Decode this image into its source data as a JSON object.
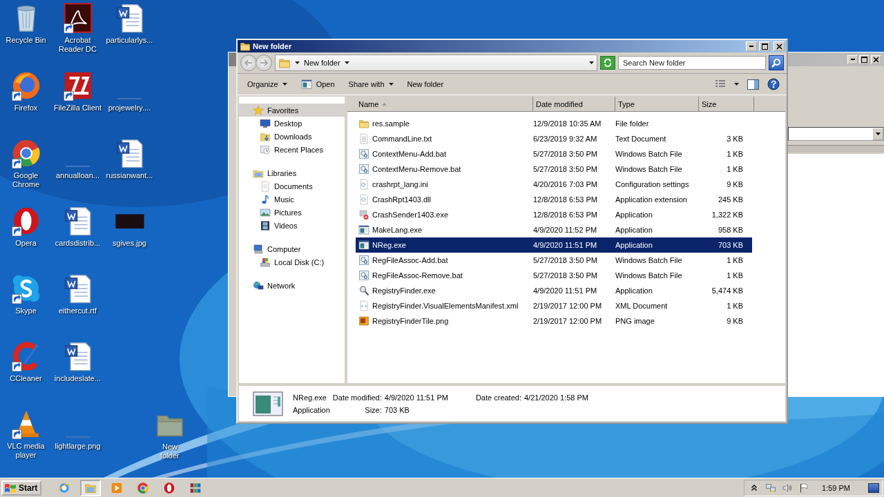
{
  "desktop": {
    "icons": [
      {
        "label": "Recycle Bin",
        "kind": "recycle",
        "shortcut": false
      },
      {
        "label": "Firefox",
        "kind": "firefox",
        "shortcut": true
      },
      {
        "label": "Google Chrome",
        "kind": "chrome",
        "shortcut": true
      },
      {
        "label": "Opera",
        "kind": "opera",
        "shortcut": true
      },
      {
        "label": "Skype",
        "kind": "skype",
        "shortcut": true
      },
      {
        "label": "CCleaner",
        "kind": "ccleaner",
        "shortcut": true
      },
      {
        "label": "VLC media player",
        "kind": "vlc",
        "shortcut": true
      },
      {
        "label": "Acrobat Reader DC",
        "kind": "pdf",
        "shortcut": true
      },
      {
        "label": "FileZilla Client",
        "kind": "filezilla",
        "shortcut": true
      },
      {
        "label": "annualloan...",
        "kind": "blank",
        "shortcut": false
      },
      {
        "label": "cardsdistrib...",
        "kind": "word",
        "shortcut": false
      },
      {
        "label": "eithercut.rtf",
        "kind": "word",
        "shortcut": false
      },
      {
        "label": "includeslate...",
        "kind": "word",
        "shortcut": false
      },
      {
        "label": "lightlarge.png",
        "kind": "blank",
        "shortcut": false
      },
      {
        "label": "particularlys...",
        "kind": "word",
        "shortcut": false
      },
      {
        "label": "projewelry....",
        "kind": "blank",
        "shortcut": false
      },
      {
        "label": "russianwant...",
        "kind": "word",
        "shortcut": false
      },
      {
        "label": "sgives.jpg",
        "kind": "darkimage",
        "shortcut": false
      }
    ],
    "dragged_icon": {
      "label": "New folder",
      "kind": "folder"
    }
  },
  "explorer": {
    "title": "New folder",
    "address": {
      "crumb": "New folder"
    },
    "search": {
      "placeholder": "Search New folder"
    },
    "toolbar": [
      {
        "label": "Organize",
        "kind": "menu"
      },
      {
        "label": "Open",
        "kind": "open"
      },
      {
        "label": "Share with",
        "kind": "menu"
      },
      {
        "label": "New folder",
        "kind": "plain"
      }
    ],
    "navigation": [
      {
        "label": "Favorites",
        "kind": "star",
        "selected": true,
        "children": [
          {
            "label": "Desktop",
            "kind": "desktop",
            "selected": false
          },
          {
            "label": "Downloads",
            "kind": "downloads",
            "selected": false
          },
          {
            "label": "Recent Places",
            "kind": "recent",
            "selected": false
          }
        ]
      },
      {
        "label": "Libraries",
        "kind": "libraries",
        "selected": false,
        "children": [
          {
            "label": "Documents",
            "kind": "documents",
            "selected": false
          },
          {
            "label": "Music",
            "kind": "music",
            "selected": false
          },
          {
            "label": "Pictures",
            "kind": "pictures",
            "selected": false
          },
          {
            "label": "Videos",
            "kind": "videos",
            "selected": false
          }
        ]
      },
      {
        "label": "Computer",
        "kind": "computer",
        "selected": false,
        "children": [
          {
            "label": "Local Disk (C:)",
            "kind": "disk",
            "selected": false
          }
        ]
      },
      {
        "label": "Network",
        "kind": "network",
        "selected": false
      }
    ],
    "columns": [
      {
        "label": "Name",
        "sorted": true
      },
      {
        "label": "Date modified",
        "sorted": false
      },
      {
        "label": "Type",
        "sorted": false
      },
      {
        "label": "Size",
        "sorted": false
      }
    ],
    "rows": [
      {
        "name": "res.sample",
        "date": "12/9/2018 10:35 AM",
        "type": "File folder",
        "kind": "folder",
        "selected": false
      },
      {
        "name": "CommandLine.txt",
        "date": "6/23/2019 9:32 AM",
        "type": "Text Document",
        "size": "3 KB",
        "kind": "text",
        "selected": false
      },
      {
        "name": "ContextMenu-Add.bat",
        "date": "5/27/2018 3:50 PM",
        "type": "Windows Batch File",
        "size": "1 KB",
        "kind": "batch",
        "selected": false
      },
      {
        "name": "ContextMenu-Remove.bat",
        "date": "5/27/2018 3:50 PM",
        "type": "Windows Batch File",
        "size": "1 KB",
        "kind": "batch",
        "selected": false
      },
      {
        "name": "crashrpt_lang.ini",
        "date": "4/20/2016 7:03 PM",
        "type": "Configuration settings",
        "size": "9 KB",
        "kind": "ini",
        "selected": false
      },
      {
        "name": "CrashRpt1403.dll",
        "date": "12/8/2018 6:53 PM",
        "type": "Application extension",
        "size": "245 KB",
        "kind": "dll",
        "selected": false
      },
      {
        "name": "CrashSender1403.exe",
        "date": "12/8/2018 6:53 PM",
        "type": "Application",
        "size": "1,322 KB",
        "kind": "crash",
        "selected": false
      },
      {
        "name": "MakeLang.exe",
        "date": "4/9/2020 11:52 PM",
        "type": "Application",
        "size": "958 KB",
        "kind": "app",
        "selected": false
      },
      {
        "name": "NReg.exe",
        "date": "4/9/2020 11:51 PM",
        "type": "Application",
        "size": "703 KB",
        "kind": "app",
        "selected": true
      },
      {
        "name": "RegFileAssoc-Add.bat",
        "date": "5/27/2018 3:50 PM",
        "type": "Windows Batch File",
        "size": "1 KB",
        "kind": "batch",
        "selected": false
      },
      {
        "name": "RegFileAssoc-Remove.bat",
        "date": "5/27/2018 3:50 PM",
        "type": "Windows Batch File",
        "size": "1 KB",
        "kind": "batch",
        "selected": false
      },
      {
        "name": "RegistryFinder.exe",
        "date": "4/9/2020 11:51 PM",
        "type": "Application",
        "size": "5,474 KB",
        "kind": "search",
        "selected": false
      },
      {
        "name": "RegistryFinder.VisualElementsManifest.xml",
        "date": "2/19/2017 12:00 PM",
        "type": "XML Document",
        "size": "1 KB",
        "kind": "xml",
        "selected": false
      },
      {
        "name": "RegistryFinderTile.png",
        "date": "2/19/2017 12:00 PM",
        "type": "PNG image",
        "size": "9 KB",
        "kind": "png",
        "selected": false
      }
    ],
    "details": {
      "name": "NReg.exe",
      "type": "Application",
      "fields": [
        {
          "label": "Date modified:",
          "value": "4/9/2020 11:51 PM"
        },
        {
          "label": "Date created:",
          "value": "4/21/2020 1:58 PM"
        },
        {
          "label": "Size:",
          "value": "703 KB"
        }
      ]
    }
  },
  "taskbar": {
    "start": "Start",
    "apps": [
      {
        "kind": "ie",
        "active": false
      },
      {
        "kind": "explorer",
        "active": true
      },
      {
        "kind": "media",
        "active": false
      },
      {
        "kind": "chrome",
        "active": false
      },
      {
        "kind": "opera",
        "active": false
      },
      {
        "kind": "winrar",
        "active": false
      }
    ],
    "tray": [
      {
        "kind": "chevron"
      },
      {
        "kind": "network"
      },
      {
        "kind": "volume"
      },
      {
        "kind": "flag"
      }
    ],
    "clock": "1:59 PM"
  }
}
